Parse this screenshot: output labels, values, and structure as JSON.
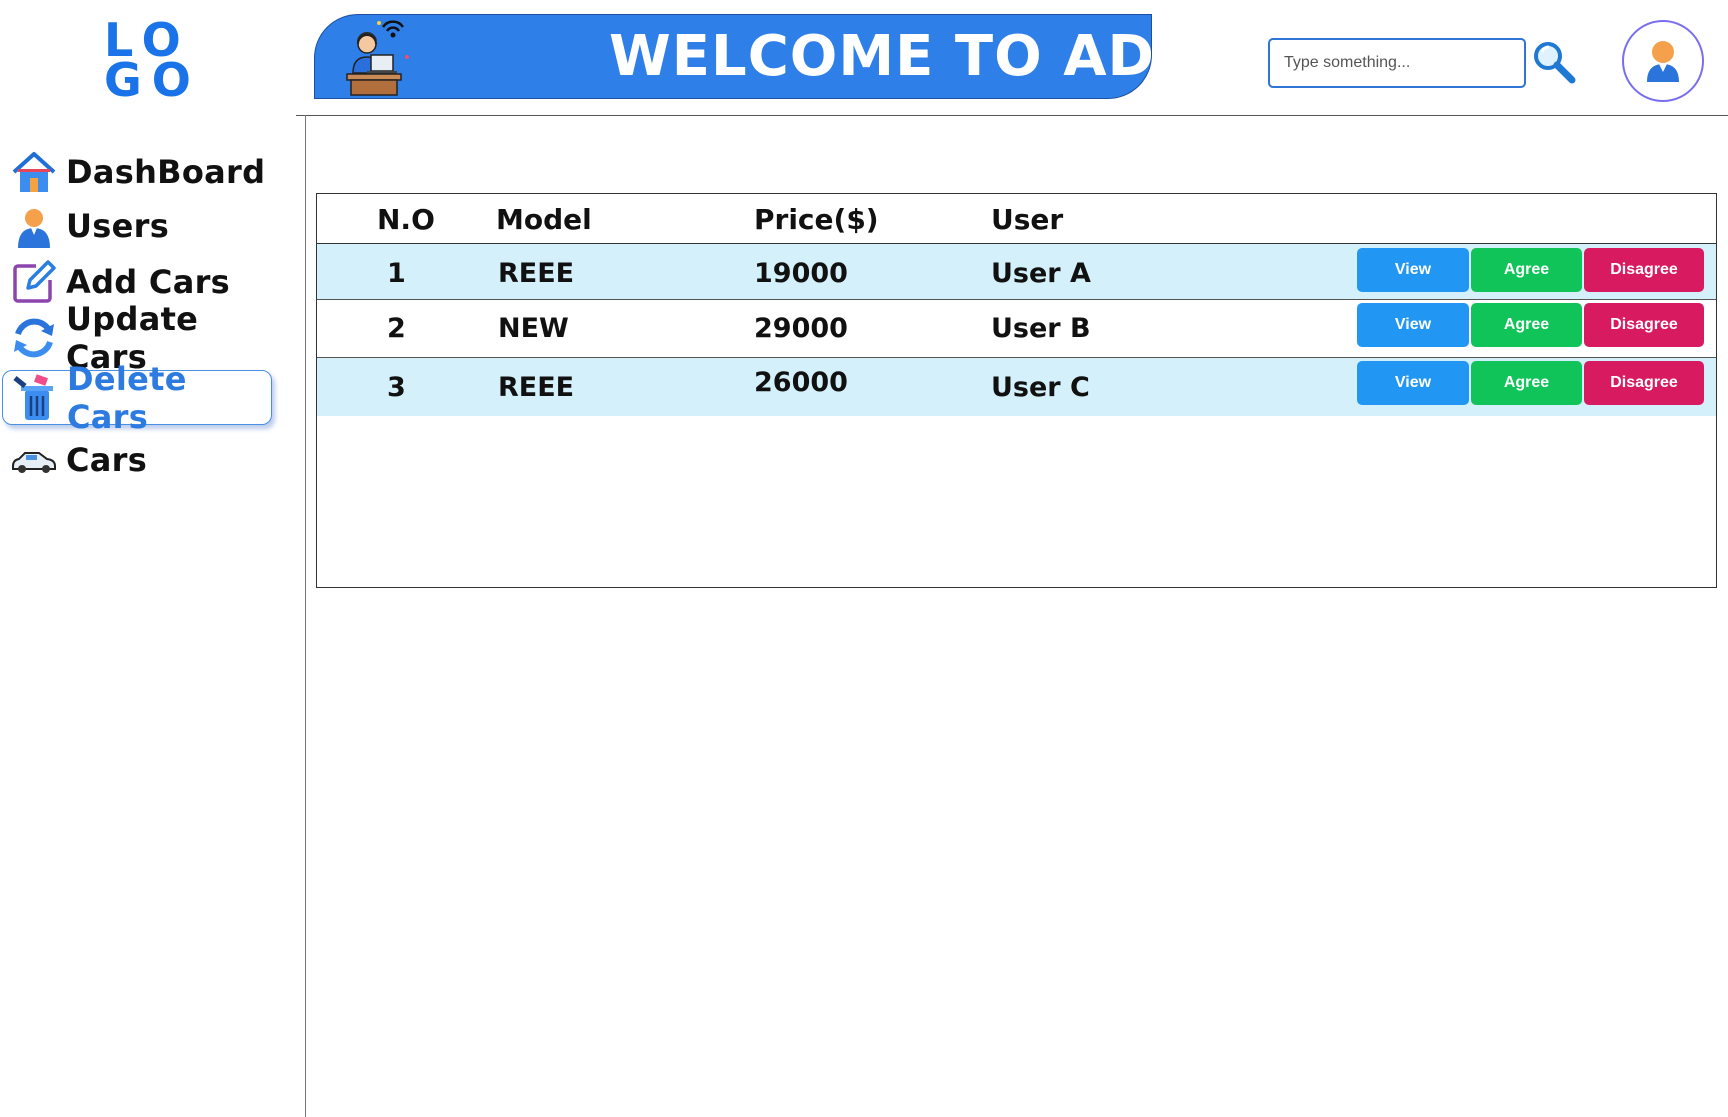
{
  "logo": {
    "line1": "LO",
    "line2": "GO"
  },
  "header": {
    "banner_text": "WELCOME TO ADMI",
    "search": {
      "placeholder": "Type something..."
    }
  },
  "sidebar": {
    "items": [
      {
        "label": "DashBoard",
        "icon": "house-icon",
        "active": false
      },
      {
        "label": "Users",
        "icon": "user-icon",
        "active": false
      },
      {
        "label": "Add Cars",
        "icon": "edit-icon",
        "active": false
      },
      {
        "label": "Update Cars",
        "icon": "refresh-icon",
        "active": false
      },
      {
        "label": "Delete Cars",
        "icon": "trash-icon",
        "active": true
      },
      {
        "label": "Cars",
        "icon": "car-icon",
        "active": false
      }
    ]
  },
  "table": {
    "columns": [
      "N.O",
      "Model",
      "Price($)",
      "User"
    ],
    "rows": [
      {
        "no": "1",
        "model": "REEE",
        "price": "19000",
        "user": "User A"
      },
      {
        "no": "2",
        "model": "NEW",
        "price": "29000",
        "user": "User B"
      },
      {
        "no": "3",
        "model": "REEE",
        "price": "26000",
        "user": "User C"
      }
    ],
    "actions": {
      "view": "View",
      "agree": "Agree",
      "disagree": "Disagree"
    }
  },
  "colors": {
    "accent": "#2e7fe8",
    "active_nav": "#2d7be0",
    "row_tint": "#d4f1fb",
    "view": "#2196f3",
    "agree": "#11c45a",
    "disagree": "#d81b60"
  }
}
